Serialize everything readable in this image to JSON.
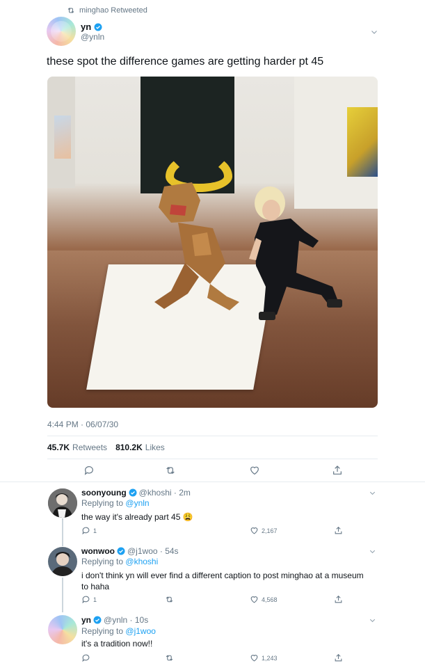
{
  "retweet": {
    "label": "minghao Retweeted"
  },
  "tweet": {
    "name": "yn",
    "handle": "@ynln",
    "text": "these spot the difference games are getting harder pt 45",
    "timestamp": "4:44 PM · 06/07/30",
    "retweets_count": "45.7K",
    "retweets_label": "Retweets",
    "likes_count": "810.2K",
    "likes_label": "Likes"
  },
  "replies": [
    {
      "name": "soonyoung",
      "handle_time": "@khoshi · 2m",
      "replying_prefix": "Replying to",
      "replying_to": "@ynln",
      "text": "the way it's already part 45 😩",
      "reply_count": "1",
      "like_count": "2,167"
    },
    {
      "name": "wonwoo",
      "handle_time": "@j1woo · 54s",
      "replying_prefix": "Replying to",
      "replying_to": "@khoshi",
      "text_line1": "i don't think yn will ever find a different caption to post minghao at a museum",
      "text_line2": "to haha",
      "reply_count": "1",
      "like_count": "4,568"
    },
    {
      "name": "yn",
      "handle_time": "@ynln · 10s",
      "replying_prefix": "Replying to",
      "replying_to": "@j1woo",
      "text": "it's a tradition now!!",
      "like_count": "1,243"
    }
  ],
  "colors": {
    "accent": "#1da1f2",
    "muted": "#657786",
    "divider": "#e6ecf0"
  }
}
